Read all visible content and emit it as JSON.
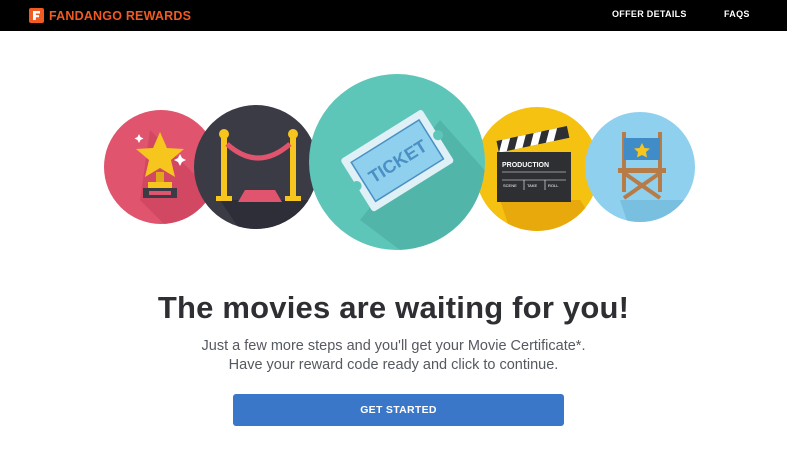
{
  "header": {
    "brand_primary": "FANDANGO",
    "brand_secondary": "REWARDS",
    "nav": [
      {
        "label": "OFFER DETAILS"
      },
      {
        "label": "FAQS"
      }
    ]
  },
  "hero": {
    "ticket_text": "TICKET",
    "clapper_text": "PRODUCTION",
    "clapper_fields": [
      "SCENE",
      "TAKE",
      "ROLL"
    ],
    "icons": [
      "trophy-star-icon",
      "velvet-rope-icon",
      "ticket-icon",
      "clapperboard-icon",
      "directors-chair-icon"
    ],
    "colors": {
      "pink": "#e0546d",
      "dark": "#3a3b45",
      "teal": "#5ec6b8",
      "yellow": "#f5c211",
      "sky": "#8fd0ee"
    }
  },
  "main": {
    "headline": "The movies are waiting for you!",
    "subline_1": "Just a few more steps and you'll get your Movie Certificate*.",
    "subline_2": "Have your reward code ready and click to continue.",
    "cta_label": "GET STARTED"
  },
  "theme": {
    "accent": "#3b77c9",
    "brand_orange": "#f15a22",
    "header_bg": "#000000"
  }
}
